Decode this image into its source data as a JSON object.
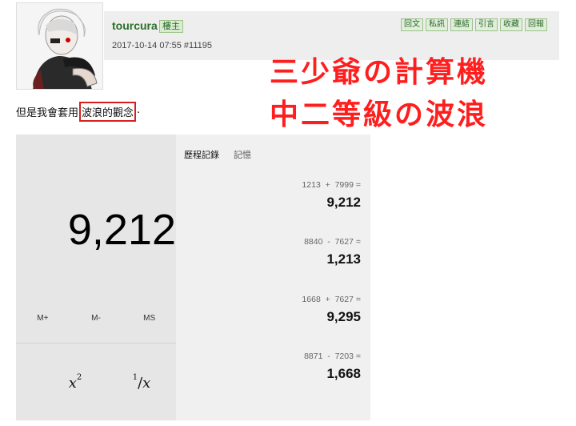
{
  "post": {
    "username": "tourcura",
    "badge": "樓主",
    "meta": "2017-10-14 07:55  #11195",
    "actions": [
      "回文",
      "私訊",
      "連結",
      "引言",
      "收藏",
      "回報"
    ]
  },
  "overlay": {
    "line1": "三少爺の計算機",
    "line2": "中二等級の波浪"
  },
  "caption": {
    "prefix": "但是我會套用",
    "highlight": "波浪的觀念",
    "suffix": "·"
  },
  "calculator": {
    "display": "9,212",
    "memory": [
      "M+",
      "M-",
      "MS"
    ],
    "keys": {
      "square_base": "x",
      "square_exp": "2",
      "recip_num": "1",
      "recip_den": "x"
    },
    "tabs": [
      "歷程記錄",
      "記憶"
    ],
    "history": [
      {
        "expr": "1213  +  7999 =",
        "result": "9,212"
      },
      {
        "expr": "8840  -  7627 =",
        "result": "1,213"
      },
      {
        "expr": "1668  +  7627 =",
        "result": "9,295"
      },
      {
        "expr": "8871  -  7203 =",
        "result": "1,668"
      }
    ]
  }
}
